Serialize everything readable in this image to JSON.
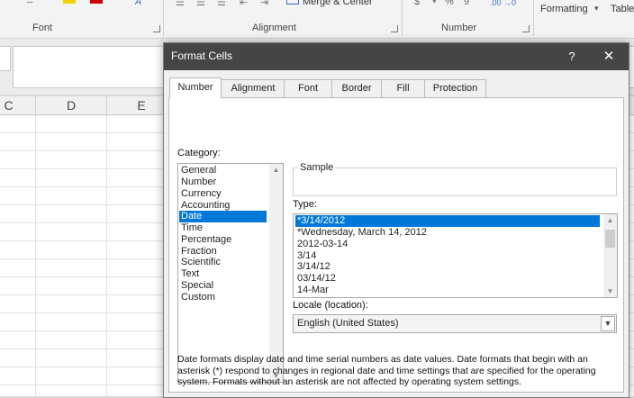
{
  "ribbon": {
    "groups": [
      {
        "label": "Font"
      },
      {
        "label": "Alignment"
      },
      {
        "label": "Number"
      }
    ],
    "merge_center": "Merge & Center",
    "number_format_hint": ".00 →0",
    "formatting": "Formatting",
    "table": "Table"
  },
  "columns": [
    "C",
    "D",
    "E"
  ],
  "dialog": {
    "title": "Format Cells",
    "help": "?",
    "close": "✕",
    "tabs": [
      "Number",
      "Alignment",
      "Font",
      "Border",
      "Fill",
      "Protection"
    ],
    "category_label": "Category:",
    "categories": [
      "General",
      "Number",
      "Currency",
      "Accounting",
      "Date",
      "Time",
      "Percentage",
      "Fraction",
      "Scientific",
      "Text",
      "Special",
      "Custom"
    ],
    "selected_category": "Date",
    "sample_label": "Sample",
    "sample_value": "",
    "type_label": "Type:",
    "types": [
      "*3/14/2012",
      "*Wednesday, March 14, 2012",
      "2012-03-14",
      "3/14",
      "3/14/12",
      "03/14/12",
      "14-Mar"
    ],
    "selected_type": "*3/14/2012",
    "locale_label": "Locale (location):",
    "locale_value": "English (United States)",
    "description": "Date formats display date and time serial numbers as date values.  Date formats that begin with an asterisk (*) respond to changes in regional date and time settings that are specified for the operating system. Formats without an asterisk are not affected by operating system settings."
  },
  "colors": {
    "titlebar": "#454545",
    "selection": "#0078d7",
    "dialog_bg": "#f0f0f0"
  }
}
